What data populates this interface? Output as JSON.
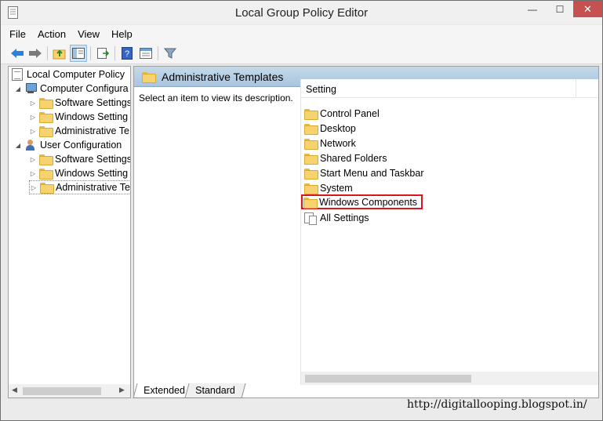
{
  "window": {
    "title": "Local Group Policy Editor"
  },
  "controls": {
    "minimize": "—",
    "maximize": "☐",
    "close": "✕"
  },
  "menu": [
    "File",
    "Action",
    "View",
    "Help"
  ],
  "tree": {
    "root": "Local Computer Policy",
    "computer": {
      "label": "Computer Configura",
      "children": [
        "Software Settings",
        "Windows Setting",
        "Administrative Te"
      ]
    },
    "user": {
      "label": "User Configuration",
      "children": [
        "Software Settings",
        "Windows Setting",
        "Administrative Te"
      ]
    }
  },
  "content": {
    "title": "Administrative Templates",
    "description": "Select an item to view its description.",
    "column_header": "Setting",
    "items": [
      "Control Panel",
      "Desktop",
      "Network",
      "Shared Folders",
      "Start Menu and Taskbar",
      "System",
      "Windows Components",
      "All Settings"
    ]
  },
  "tabs": [
    "Extended",
    "Standard"
  ],
  "watermark": "http://digitallooping.blogspot.in/",
  "colors": {
    "highlight_border": "#d6181e",
    "header_gradient": "#b7cfe4"
  }
}
